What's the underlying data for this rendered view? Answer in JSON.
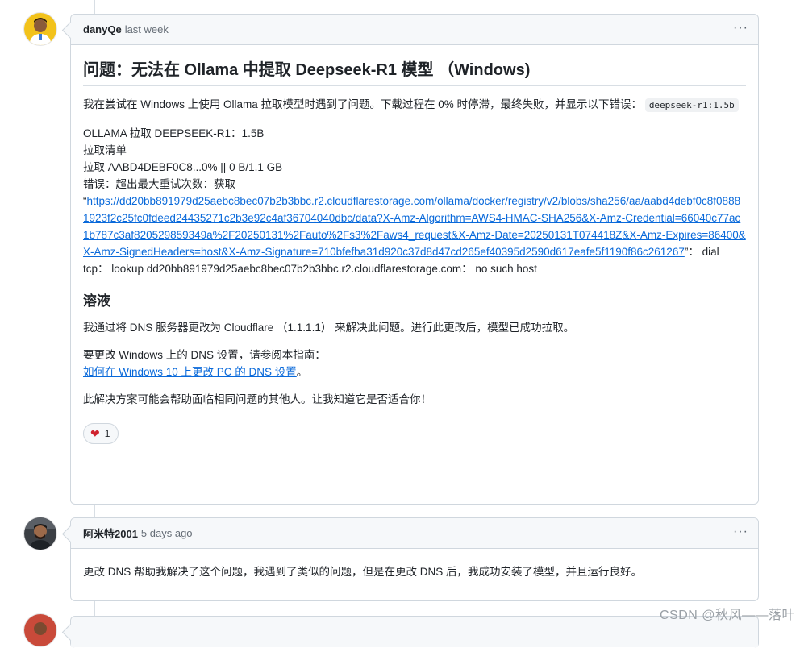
{
  "comments": [
    {
      "author": "danyQe",
      "time": "last week",
      "more": "···",
      "title": "问题：无法在 Ollama 中提取 Deepseek-R1 模型 （Windows)",
      "intro_text": "我在尝试在 Windows 上使用 Ollama 拉取模型时遇到了问题。下载过程在 0% 时停滞，最终失败，并显示以下错误：",
      "intro_code": "deepseek-r1:1.5b",
      "log_lines": [
        "OLLAMA 拉取 DEEPSEEK-R1：1.5B",
        "拉取清单",
        "拉取 AABD4DEBF0C8...0%  ||  0 B/1.1 GB",
        "错误：超出最大重试次数：获取"
      ],
      "error_prefix": "“",
      "error_link": "https://dd20bb891979d25aebc8bec07b2b3bbc.r2.cloudflarestorage.com/ollama/docker/registry/v2/blobs/sha256/aa/aabd4debf0c8f08881923f2c25fc0fdeed24435271c2b3e92c4af36704040dbc/data?X-Amz-Algorithm=AWS4-HMAC-SHA256&X-Amz-Credential=66040c77ac1b787c3af820529859349a%2F20250131%2Fauto%2Fs3%2Faws4_request&X-Amz-Date=20250131T074418Z&X-Amz-Expires=86400&X-Amz-SignedHeaders=host&X-Amz-Signature=710bfefba31d920c37d8d47cd265ef40395d2590d617eafe5f1190f86c261267",
      "error_suffix": "”：  dial tcp：  lookup dd20bb891979d25aebc8bec07b2b3bbc.r2.cloudflarestorage.com：  no such host",
      "solution_heading": "溶液",
      "solution_text": "我通过将 DNS 服务器更改为 Cloudflare （1.1.1.1） 来解决此问题。进行此更改后，模型已成功拉取。",
      "guide_text": "要更改 Windows 上的 DNS 设置，请参阅本指南：",
      "guide_link": "如何在 Windows 10 上更改 PC 的 DNS 设置",
      "guide_end": "。",
      "closing_text": "此解决方案可能会帮助面临相同问题的其他人。让我知道它是否适合你！",
      "reaction_icon": "heart-icon",
      "reaction_count": "1"
    },
    {
      "author": "阿米特2001",
      "time": "5 days ago",
      "more": "···",
      "text": "更改 DNS 帮助我解决了这个问题，我遇到了类似的问题，但是在更改 DNS 后，我成功安装了模型，并且运行良好。"
    }
  ],
  "watermark": "CSDN @秋风——落叶",
  "colors": {
    "link": "#0969da",
    "border": "#d0d7de",
    "header_bg": "#f6f8fa",
    "heart": "#cf222e"
  }
}
